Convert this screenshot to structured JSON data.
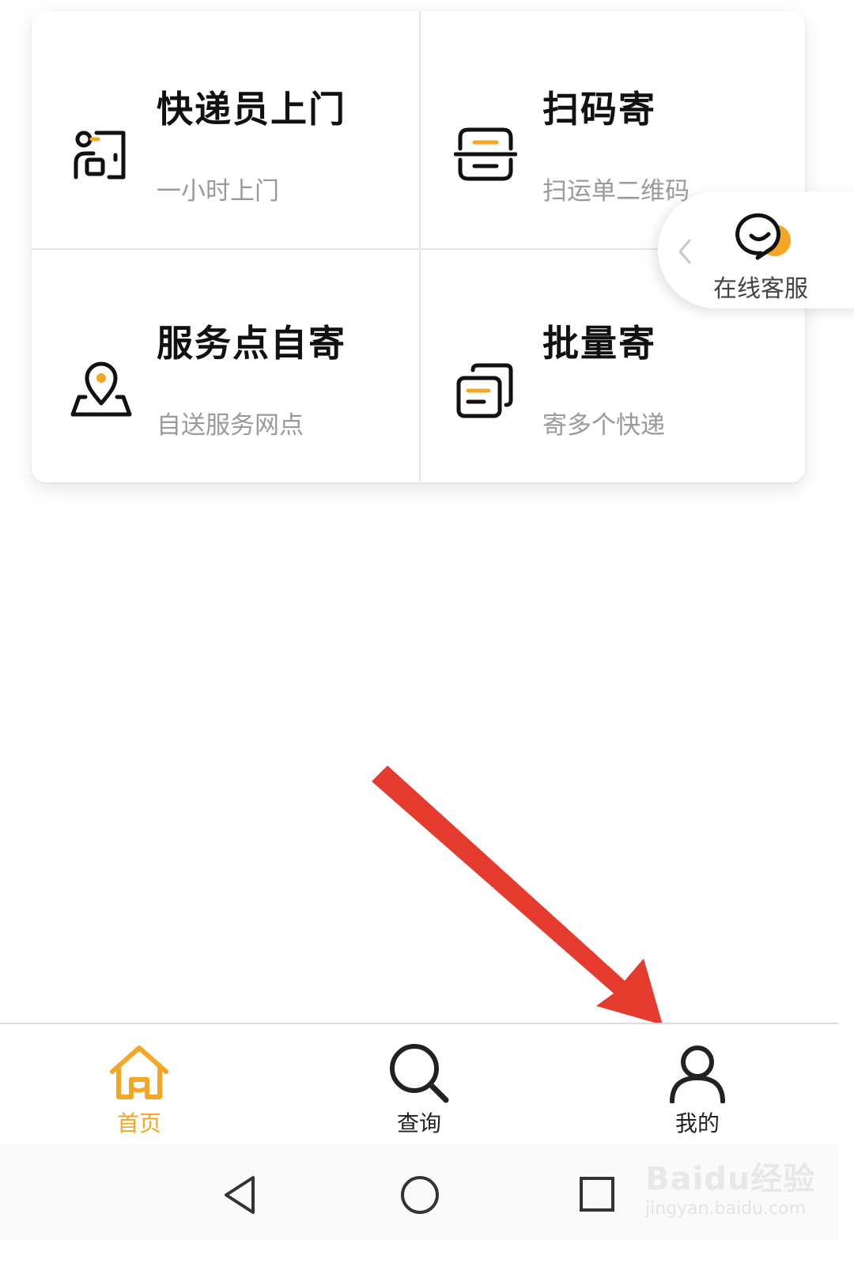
{
  "colors": {
    "accent": "#f5a623",
    "arrow": "#e53b2f",
    "text": "#111111",
    "subtext": "#9a9a9a"
  },
  "services": [
    {
      "title": "快递员上门",
      "subtitle": "一小时上门",
      "icon": "courier-door-icon"
    },
    {
      "title": "扫码寄",
      "subtitle": "扫运单二维码",
      "icon": "scan-code-icon"
    },
    {
      "title": "服务点自寄",
      "subtitle": "自送服务网点",
      "icon": "location-pin-icon"
    },
    {
      "title": "批量寄",
      "subtitle": "寄多个快递",
      "icon": "stacked-documents-icon"
    }
  ],
  "customer_service": {
    "label": "在线客服",
    "icon": "chat-bubble-icon"
  },
  "tabbar": [
    {
      "label": "首页",
      "icon": "home-icon",
      "active": true
    },
    {
      "label": "查询",
      "icon": "search-icon",
      "active": false
    },
    {
      "label": "我的",
      "icon": "person-icon",
      "active": false
    }
  ],
  "navbar": [
    "back-triangle-icon",
    "home-circle-icon",
    "recents-square-icon"
  ],
  "watermark": {
    "logo": "Baidu经验",
    "url": "jingyan.baidu.com"
  }
}
